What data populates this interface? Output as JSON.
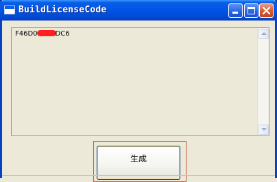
{
  "window": {
    "title": "BuildLicenseCode",
    "controls": {
      "minimize_icon": "minimize-icon",
      "maximize_icon": "maximize-icon",
      "close_icon": "close-icon"
    }
  },
  "output": {
    "text_prefix": "F46D0",
    "text_suffix": "DC6",
    "scroll_up_icon": "chevron-up-icon",
    "scroll_down_icon": "chevron-down-icon"
  },
  "actions": {
    "generate_label": "生成"
  },
  "colors": {
    "titlebar": "#0054e3",
    "window_border": "#0842c4",
    "face": "#ece9d8",
    "redaction": "#ff2020",
    "highlight_outline": "#d2513b"
  }
}
